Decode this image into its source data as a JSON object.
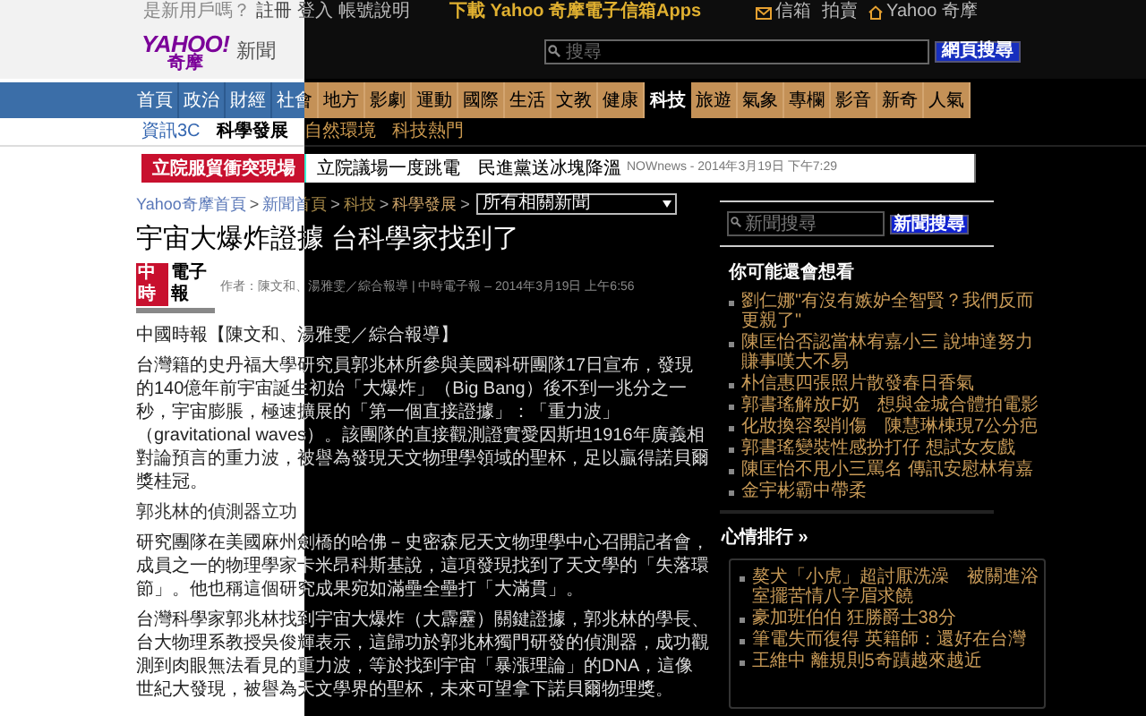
{
  "top_bar": {
    "links": [
      {
        "kind": "text",
        "label": "是新用戶嗎？"
      },
      {
        "kind": "link",
        "label": "註冊"
      },
      {
        "kind": "link",
        "label": "登入"
      },
      {
        "kind": "link",
        "label": "帳號說明"
      }
    ],
    "promo": "下載 Yahoo 奇摩電子信箱Apps",
    "right_links": [
      {
        "kind": "mail",
        "label": "信箱"
      },
      {
        "kind": "plain",
        "label": "拍賣"
      },
      {
        "kind": "home",
        "label": "Yahoo 奇摩"
      }
    ]
  },
  "header": {
    "logo": "YAHOO!",
    "logo_sub": "奇摩",
    "section": "新聞",
    "search": {
      "placeholder": "搜尋",
      "button": "網頁搜尋"
    }
  },
  "nav": [
    {
      "label": "首頁",
      "selected": false
    },
    {
      "label": "政治",
      "selected": false
    },
    {
      "label": "財經",
      "selected": false
    },
    {
      "label": "社會",
      "selected": false
    },
    {
      "label": "地方",
      "selected": false
    },
    {
      "label": "影劇",
      "selected": false
    },
    {
      "label": "運動",
      "selected": false
    },
    {
      "label": "國際",
      "selected": false
    },
    {
      "label": "生活",
      "selected": false
    },
    {
      "label": "文教",
      "selected": false
    },
    {
      "label": "健康",
      "selected": false
    },
    {
      "label": "科技",
      "selected": true
    },
    {
      "label": "旅遊",
      "selected": false
    },
    {
      "label": "氣象",
      "selected": false
    },
    {
      "label": "專欄",
      "selected": false
    },
    {
      "label": "影音",
      "selected": false
    },
    {
      "label": "新奇",
      "selected": false
    },
    {
      "label": "人氣",
      "selected": false
    }
  ],
  "sub_nav": [
    {
      "label": "資訊3C",
      "selected": false
    },
    {
      "label": "科學發展",
      "selected": true
    },
    {
      "label": "自然環境",
      "selected": false
    },
    {
      "label": "科技熱門",
      "selected": false
    }
  ],
  "breaking": {
    "label": "立院服貿衝突現場",
    "headline": "立院議場一度跳電　民進黨送冰塊降溫",
    "source": "NOWnews - 2014年3月19日 下午7:29"
  },
  "breadcrumb": [
    {
      "kind": "link",
      "label": "Yahoo奇摩首頁"
    },
    {
      "kind": "separator",
      "label": ">"
    },
    {
      "kind": "link",
      "label": "新聞首頁"
    },
    {
      "kind": "separator",
      "label": ">"
    },
    {
      "kind": "link",
      "label": "科技"
    },
    {
      "kind": "separator",
      "label": ">"
    },
    {
      "kind": "current",
      "label": "科學發展"
    },
    {
      "kind": "separator",
      "label": ">"
    }
  ],
  "related_select": "所有相關新聞",
  "article": {
    "title": "宇宙大爆炸證據 台科學家找到了",
    "logo_mark": "中時",
    "logo_text": "電子報",
    "byline": "作者：陳文和、湯雅雯／綜合報導 | 中時電子報 – 2014年3月19日 上午6:56",
    "paragraphs": [
      {
        "kind": "text",
        "text": "中國時報【陳文和、湯雅雯／綜合報導】"
      },
      {
        "kind": "text",
        "text": "台灣籍的史丹福大學研究員郭兆林所參與美國科研團隊17日宣布，發現的140億年前宇宙誕生初始「大爆炸」（Big Bang）後不到一兆分之一秒，宇宙膨脹，極速擴展的「第一個直接證據」：「重力波」（gravitational waves）。該團隊的直接觀測證實愛因斯坦1916年廣義相對論預言的重力波，被譽為發現天文物理學領域的聖杯，足以贏得諾貝爾獎桂冠。"
      },
      {
        "kind": "heading",
        "text": "郭兆林的偵測器立功"
      },
      {
        "kind": "text",
        "text": "研究團隊在美國麻州劍橋的哈佛－史密森尼天文物理學中心召開記者會，成員之一的物理學家卡米昂科斯基說，這項發現找到了天文學的「失落環節」。他也稱這個研究成果宛如滿壘全壘打「大滿貫」。"
      },
      {
        "kind": "text",
        "text": "台灣科學家郭兆林找到宇宙大爆炸（大霹靂）關鍵證據，郭兆林的學長、台大物理系教授吳俊輝表示，這歸功於郭兆林獨門研發的偵測器，成功觀測到肉眼無法看見的重力波，等於找到宇宙「暴漲理論」的DNA，這像世紀大發現，被譽為天文學界的聖杯，未來可望拿下諾貝爾物理獎。"
      }
    ]
  },
  "sidebar": {
    "search": {
      "placeholder": "新聞搜尋",
      "button": "新聞搜尋"
    },
    "recommended": {
      "title": "你可能還會想看",
      "items": [
        "劉仁娜\"有沒有嫉妒全智賢？我們反而更親了\"",
        "陳匡怡否認當林宥嘉小三 說坤達努力賺事嘆大不易",
        "朴信惠四張照片散發春日香氣",
        "郭書瑤解放F奶　想與金城合體拍電影",
        "化妝換容裂削傷　陳慧琳棟現7公分疤",
        "郭書瑤變裝性感扮打仔 想試女友戲",
        "陳匡怡不甩小三罵名 傳訊安慰林宥嘉",
        "金宇彬霸中帶柔"
      ]
    },
    "ranking": {
      "title": "心情排行 »",
      "items": [
        "獒犬「小虎」超討厭洗澡　被關進浴室擺苦情八字眉求饒",
        "豪加班伯伯 狂勝爵士38分",
        "筆電失而復得 英籍師：還好在台灣",
        "王維中 離規則5奇蹟越來越近"
      ]
    }
  }
}
